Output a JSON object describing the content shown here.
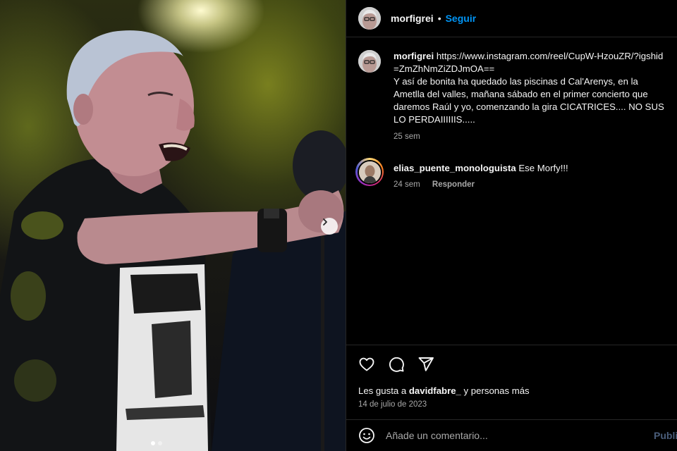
{
  "post": {
    "image_alt": "Concert photo of a smiling grey-haired man in a black t-shirt holding a microphone",
    "carousel": {
      "total": 2,
      "current": 1
    }
  },
  "header": {
    "username": "morfigrei",
    "separator": "•",
    "follow_label": "Seguir"
  },
  "caption": {
    "username": "morfigrei",
    "link": "https://www.instagram.com/reel/CupW-HzouZR/?igshid=ZmZhNmZiZDJmOA==",
    "text": "Y así de bonita ha quedado las piscinas d Cal'Arenys, en la Ametlla del valles, mañana sábado en el primer concierto que daremos Raúl y yo, comenzando la gira CICATRICES.... NO SUS LO PERDAIIIIIIS.....",
    "time": "25 sem"
  },
  "comments": [
    {
      "username": "elias_puente_monologuista",
      "text": "Ese Morfy!!!",
      "time": "24 sem",
      "reply_label": "Responder"
    }
  ],
  "actions": {
    "icons": [
      "heart-icon",
      "comment-icon",
      "share-icon"
    ]
  },
  "likes": {
    "prefix": "Les gusta a ",
    "user": "davidfabre_",
    "suffix": " y personas más"
  },
  "date": "14 de julio de 2023",
  "add_comment": {
    "placeholder": "Añade un comentario...",
    "publish_label": "Publi"
  },
  "colors": {
    "accent": "#0095f6",
    "background": "#000000",
    "muted_text": "#a8a8a8",
    "border": "#262626"
  }
}
